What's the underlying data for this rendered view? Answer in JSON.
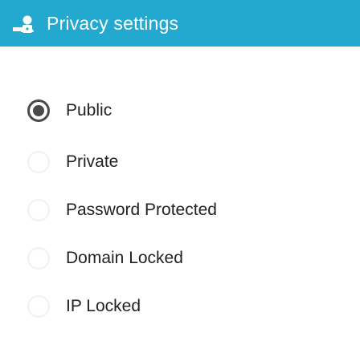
{
  "header": {
    "title": "Privacy settings",
    "icon": "privacy-icon",
    "background": "#23a8cf",
    "text_color": "#ffffff"
  },
  "privacy": {
    "selected": "Public",
    "options": [
      {
        "label": "Public",
        "selected": true
      },
      {
        "label": "Private",
        "selected": false
      },
      {
        "label": "Password Protected",
        "selected": false
      },
      {
        "label": "Domain Locked",
        "selected": false
      },
      {
        "label": "IP Locked",
        "selected": false
      }
    ]
  },
  "colors": {
    "radio_selected": "#4a4a4a",
    "radio_unselected_border": "#f0f0f0",
    "label_text": "#222222"
  }
}
